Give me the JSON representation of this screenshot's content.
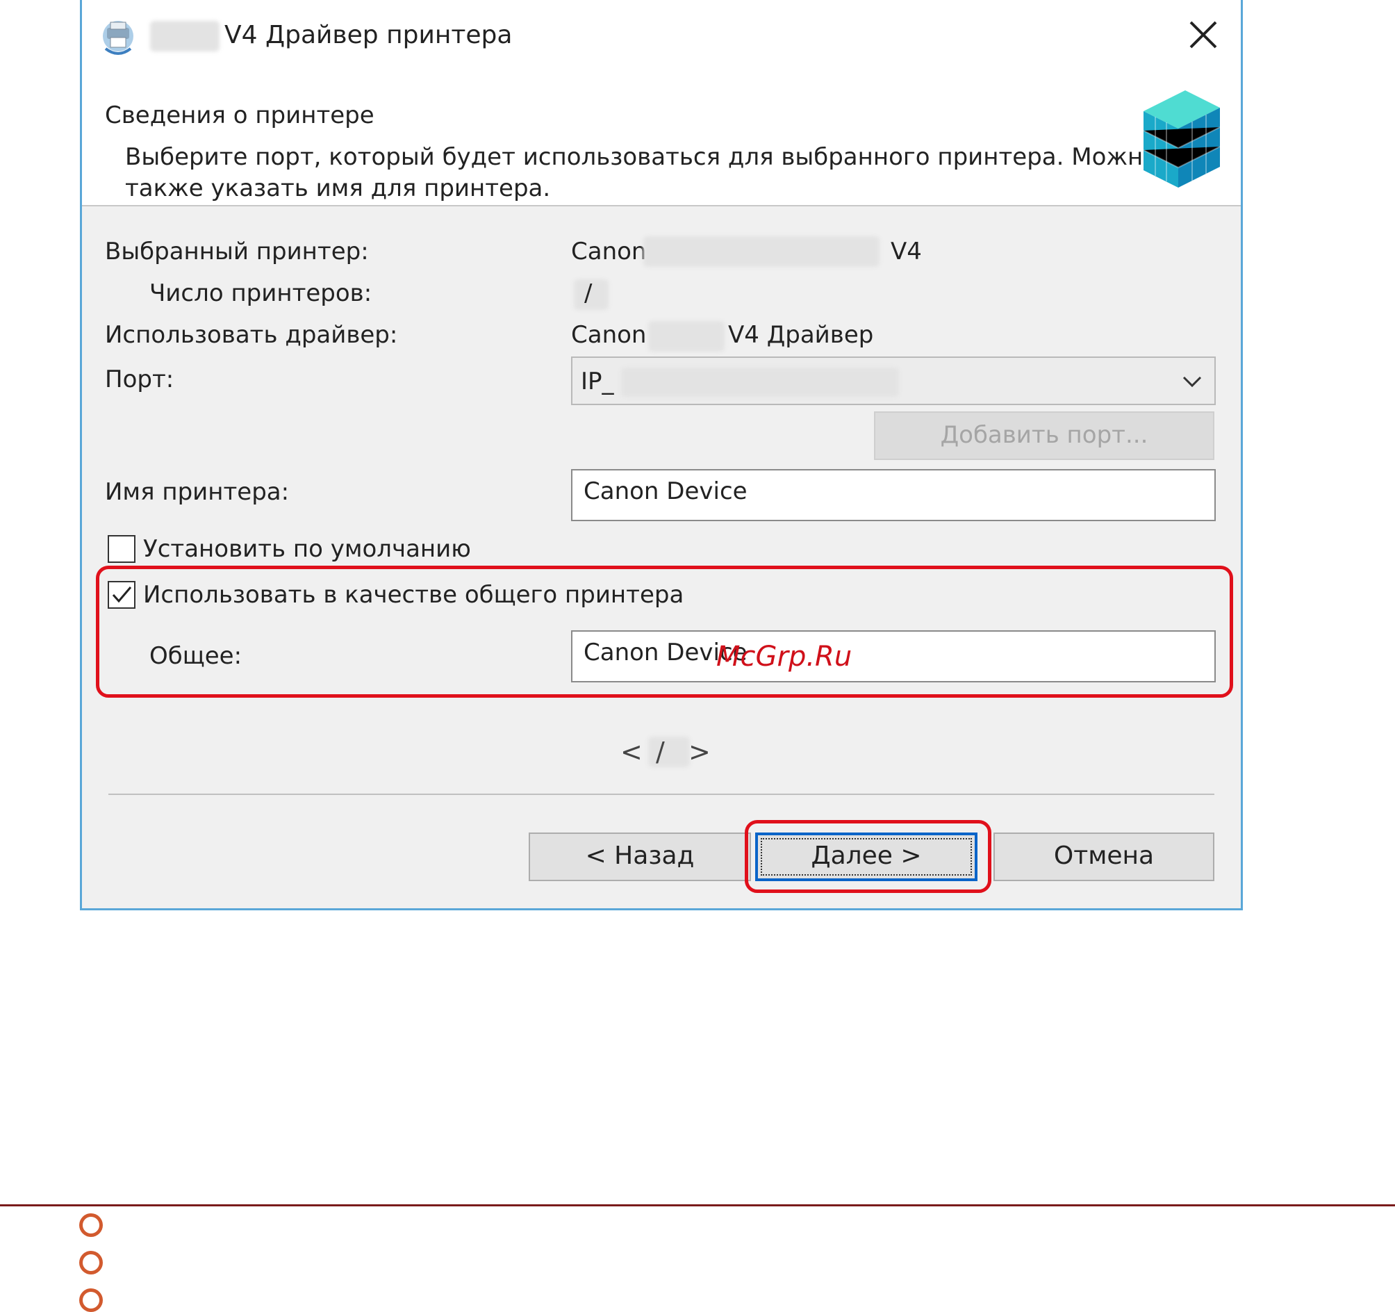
{
  "window": {
    "title": "V4 Драйвер принтера",
    "close_label": "×"
  },
  "header": {
    "title": "Сведения о принтере",
    "description": "Выберите порт, который будет использоваться для выбранного принтера. Можно также указать имя для принтера."
  },
  "form": {
    "selected_printer_label": "Выбранный принтер:",
    "selected_printer_prefix": "Canon",
    "selected_printer_suffix": "V4",
    "printer_count_label": "Число принтеров:",
    "printer_count_value": "/",
    "driver_label": "Использовать драйвер:",
    "driver_prefix": "Canon",
    "driver_suffix": "V4 Драйвер",
    "port_label": "Порт:",
    "port_value": "IP_",
    "add_port_label": "Добавить порт...",
    "printer_name_label": "Имя принтера:",
    "printer_name_value": "Canon Device",
    "set_default_label": "Установить по умолчанию",
    "set_default_checked": false,
    "share_label": "Использовать в качестве общего принтера",
    "share_checked": true,
    "share_name_label": "Общее:",
    "share_name_value": "Canon Device"
  },
  "watermark": "McGrp.Ru",
  "pager": {
    "prev": "<",
    "sep": "/",
    "next": ">"
  },
  "buttons": {
    "back": "< Назад",
    "next": "Далее >",
    "cancel": "Отмена"
  },
  "colors": {
    "highlight": "#e0101b",
    "primary_border": "#0a64c8",
    "dialog_border": "#5aa7d8",
    "bullet": "#d25a2e",
    "rule": "#7a1c1c"
  },
  "icons": [
    "printer-driver-icon",
    "close-icon",
    "cube-icon",
    "chevron-down-icon",
    "checkmark-icon",
    "bullet-arrow-icon"
  ]
}
